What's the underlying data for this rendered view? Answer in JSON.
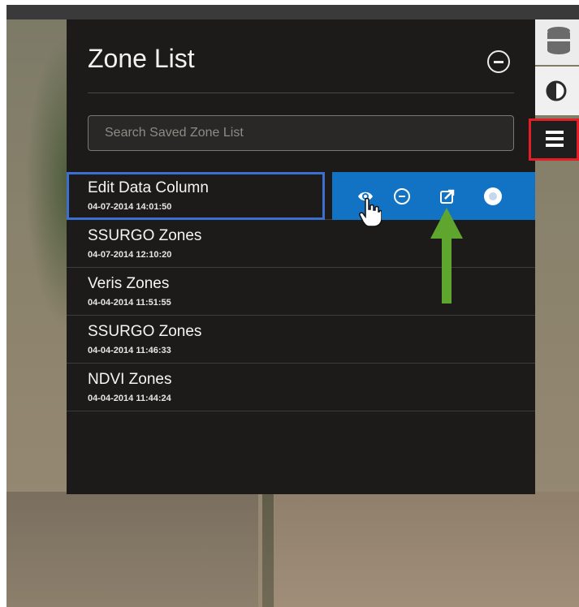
{
  "panel": {
    "title": "Zone List",
    "search_placeholder": "Search Saved Zone List"
  },
  "zones": [
    {
      "name": "Edit Data Column",
      "date": "04-07-2014 14:01:50"
    },
    {
      "name": "SSURGO Zones",
      "date": "04-07-2014 12:10:20"
    },
    {
      "name": "Veris Zones",
      "date": "04-04-2014 11:51:55"
    },
    {
      "name": "SSURGO Zones",
      "date": "04-04-2014 11:46:33"
    },
    {
      "name": "NDVI Zones",
      "date": "04-04-2014 11:44:24"
    }
  ],
  "selected_index": 0,
  "row_actions": [
    "eye-icon",
    "remove-icon",
    "export-icon",
    "record-icon"
  ],
  "sidebar": [
    "database-icon",
    "contrast-icon",
    "list-menu-icon"
  ],
  "colors": {
    "panel_bg": "#1d1b19",
    "action_bar": "#1273c4",
    "selection_border": "#3d6fd1",
    "highlight_border": "#e31e24",
    "annotation_arrow": "#5ea62e"
  }
}
